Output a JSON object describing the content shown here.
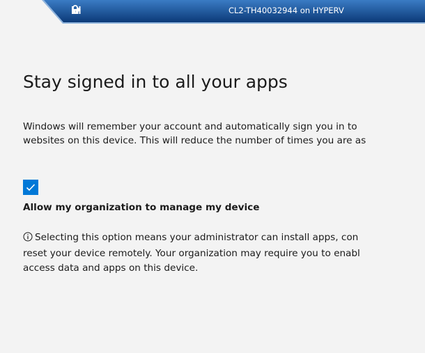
{
  "connection_bar": {
    "title": "CL2-TH40032944 on HYPERV",
    "icons": [
      "pin-icon",
      "lock-icon",
      "signal-icon"
    ],
    "colors": {
      "bar_top": "#2f6fb8",
      "bar_bottom": "#0c3a78"
    }
  },
  "main": {
    "heading": "Stay signed in to all your apps",
    "description_lines": [
      "Windows will remember your account and automatically sign you in to",
      "websites on this device. This will reduce the number of times you are as"
    ],
    "checkbox": {
      "checked": true,
      "label": "Allow my organization to manage my device",
      "color": "#0078d7"
    },
    "info_icon": "info-icon",
    "info_lines": [
      "Selecting this option means your administrator can install apps, con",
      "reset your device remotely. Your organization may require you to enabl",
      "access data and apps on this device."
    ]
  }
}
